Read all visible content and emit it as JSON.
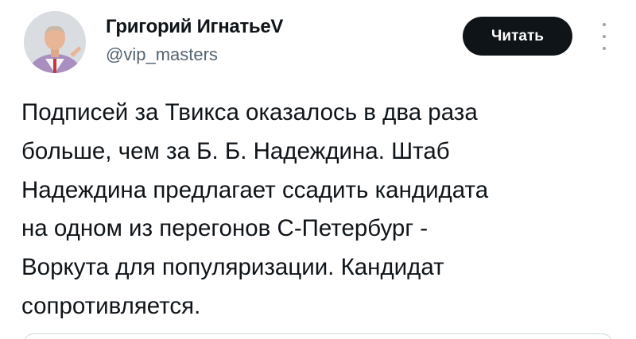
{
  "author": {
    "name": "Григорий ИгнатьеV",
    "handle": "@vip_masters"
  },
  "actions": {
    "read_label": "Читать",
    "more_icon": "more-vertical-icon"
  },
  "tweet": {
    "lines": [
      "Подписей за Твикса оказалось в два раза",
      "больше, чем за Б. Б. Надеждина. Штаб",
      "Надеждина предлагает ссадить кандидата",
      "на одном из перегонов С-Петербург -",
      "Воркута для популяризации. Кандидат",
      "сопротивляется."
    ]
  },
  "colors": {
    "text": "#0f1419",
    "secondary_text": "#536471",
    "button_bg": "#0f1419",
    "button_text": "#ffffff",
    "divider": "#cfd9de"
  }
}
